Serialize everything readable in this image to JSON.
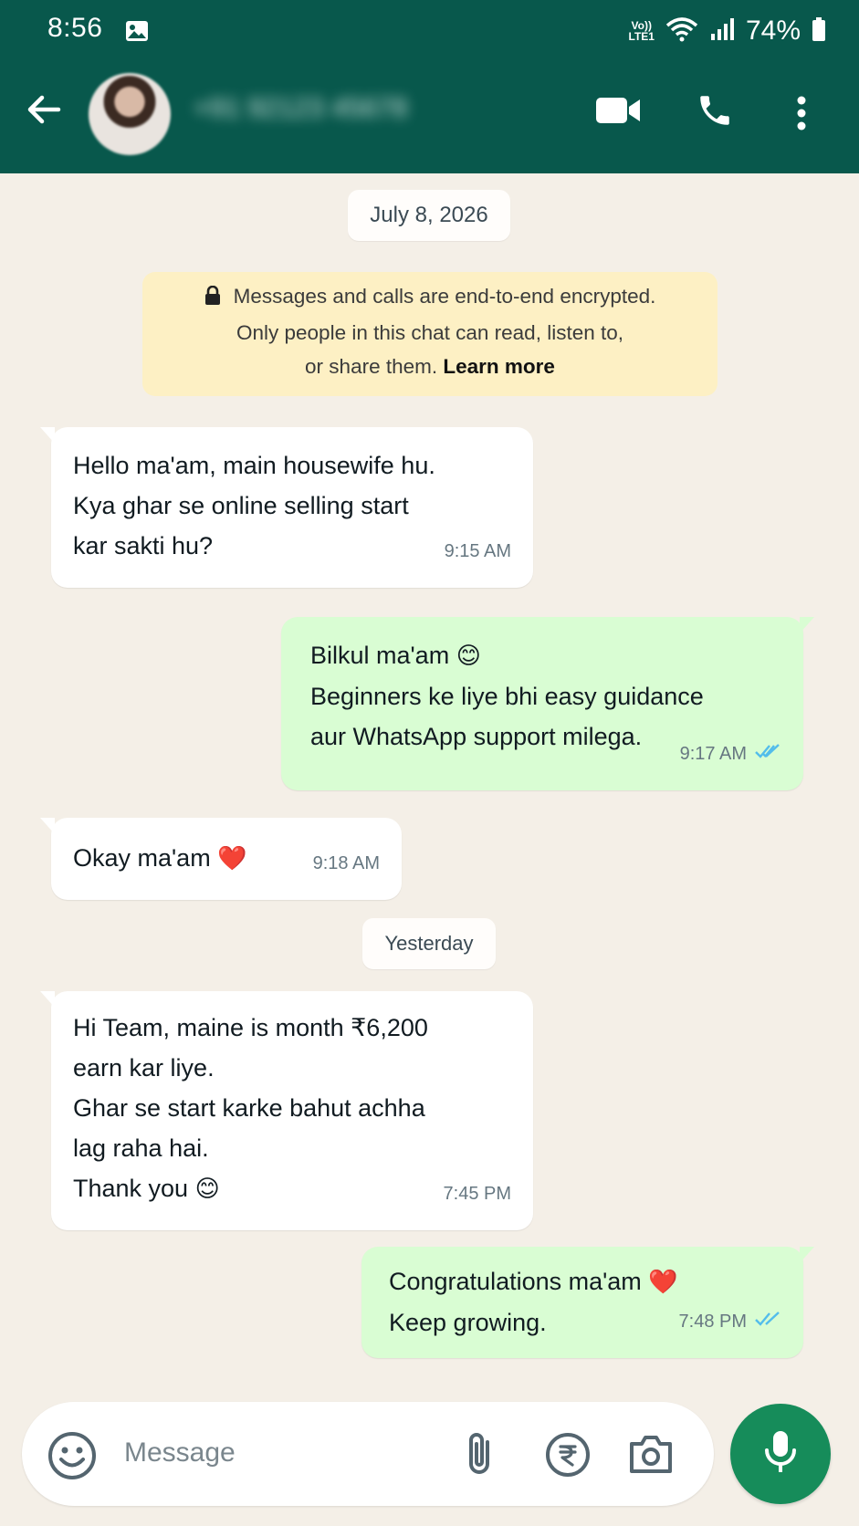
{
  "status_bar": {
    "time": "8:56",
    "volte_line1": "Vo))",
    "volte_line2": "LTE1",
    "battery": "74%"
  },
  "header": {
    "contact_name": "+91 92123 45678"
  },
  "chat": {
    "date_1": "July 8, 2026",
    "encryption": {
      "line1": "Messages and calls are end-to-end encrypted.",
      "line2": "Only people in this chat can read, listen to,",
      "line3_prefix": "or share them.",
      "learn_more": "Learn more"
    },
    "messages": [
      {
        "direction": "incoming",
        "lines": [
          "Hello ma'am, main housewife hu.",
          "Kya ghar se online selling start",
          "kar sakti hu?"
        ],
        "time": "9:15 AM"
      },
      {
        "direction": "outgoing",
        "lines": [
          "Bilkul ma'am",
          "Beginners ke liye bhi easy guidance",
          "aur WhatsApp support milega."
        ],
        "emoji": "😊",
        "time": "9:17 AM",
        "status": "read"
      },
      {
        "direction": "incoming",
        "lines": [
          "Okay ma'am"
        ],
        "emoji": "❤️",
        "time": "9:18 AM"
      },
      {
        "direction": "incoming",
        "lines": [
          "Hi Team, maine is month ₹6,200",
          "earn kar liye.",
          "Ghar se start karke bahut achha",
          "lag raha hai.",
          "Thank you"
        ],
        "emoji": "😊",
        "time": "7:45 PM"
      },
      {
        "direction": "outgoing",
        "lines": [
          "Congratulations ma'am",
          "Keep growing."
        ],
        "emoji": "❤️",
        "time": "7:48 PM",
        "status": "read"
      }
    ],
    "date_2": "Yesterday"
  },
  "composer": {
    "placeholder": "Message"
  },
  "colors": {
    "header": "#08584c",
    "chat_bg": "#f4efe7",
    "outgoing_bubble": "#d9fdd3",
    "incoming_bubble": "#ffffff",
    "encryption_bg": "#fdf0c4",
    "read_ticks": "#53bdeb",
    "mic_button": "#168c5a"
  },
  "icons": [
    "image-icon",
    "wifi-icon",
    "signal-icon",
    "battery-icon",
    "back-arrow-icon",
    "video-call-icon",
    "phone-icon",
    "more-vert-icon",
    "lock-icon",
    "double-check-icon",
    "emoji-icon",
    "attach-icon",
    "rupee-payment-icon",
    "camera-icon",
    "mic-icon"
  ]
}
